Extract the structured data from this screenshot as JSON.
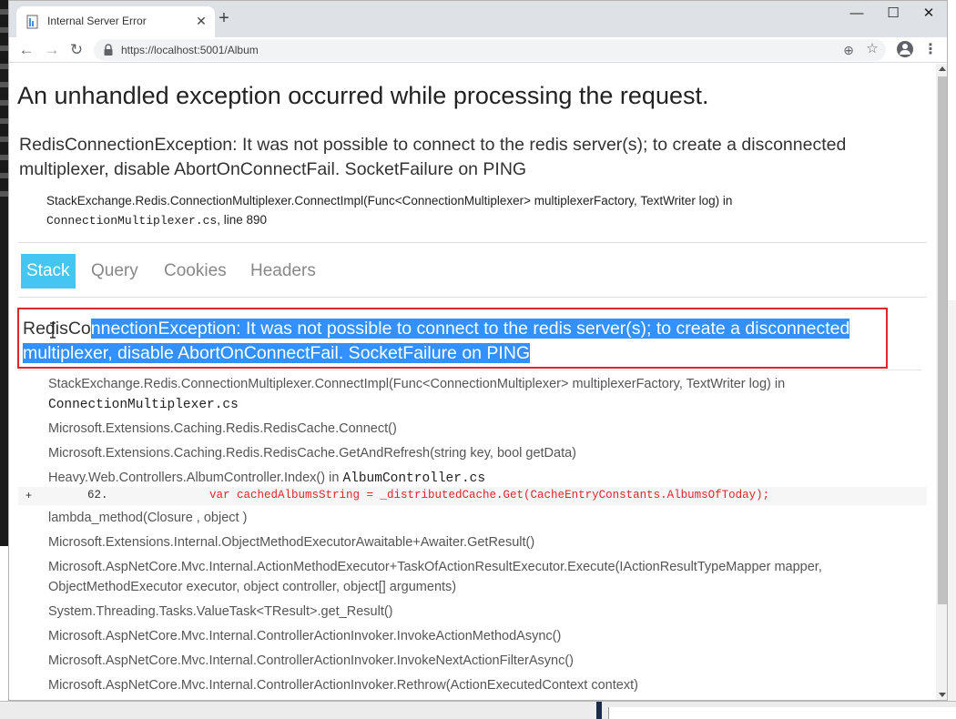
{
  "browser": {
    "tab_title": "Internal Server Error",
    "close_tab_glyph": "✕",
    "new_tab_glyph": "+",
    "url": "https://localhost:5001/Album",
    "minimize_glyph": "—",
    "maximize_glyph": "☐",
    "close_glyph": "✕",
    "back_glyph": "←",
    "forward_glyph": "→",
    "reload_glyph": "↻",
    "zoom_glyph": "⊕",
    "star_glyph": "☆",
    "menu_glyph": "⋮"
  },
  "page": {
    "heading": "An unhandled exception occurred while processing the request.",
    "title_error": "RedisConnectionException: It was not possible to connect to the redis server(s); to create a disconnected multiplexer, disable AbortOnConnectFail. SocketFailure on PING",
    "location_method": "StackExchange.Redis.ConnectionMultiplexer.ConnectImpl(Func<ConnectionMultiplexer> multiplexerFactory, TextWriter log) in",
    "location_file": "ConnectionMultiplexer.cs",
    "location_line": ", line 890",
    "tabs": [
      "Stack",
      "Query",
      "Cookies",
      "Headers"
    ],
    "selected_tab": "Stack",
    "stack_error": {
      "line1_unselected": "RedisCo",
      "line1_selected": "nnectionException: It was not possible to connect to the redis server(s); to create a disconnected",
      "line2_selected": "multiplexer, disable AbortOnConnectFail. SocketFailure on PING"
    },
    "frames": [
      {
        "method": "StackExchange.Redis.ConnectionMultiplexer.ConnectImpl(Func<ConnectionMultiplexer> multiplexerFactory, TextWriter log) in",
        "file": ""
      },
      {
        "method": "",
        "file": "ConnectionMultiplexer.cs"
      },
      {
        "method": "Microsoft.Extensions.Caching.Redis.RedisCache.Connect()",
        "file": ""
      },
      {
        "method": "Microsoft.Extensions.Caching.Redis.RedisCache.GetAndRefresh(string key, bool getData)",
        "file": ""
      },
      {
        "method": "Heavy.Web.Controllers.AlbumController.Index() in ",
        "file": "AlbumController.cs"
      },
      {
        "method": "lambda_method(Closure , object )",
        "file": ""
      },
      {
        "method": "Microsoft.Extensions.Internal.ObjectMethodExecutorAwaitable+Awaiter.GetResult()",
        "file": ""
      },
      {
        "method": "Microsoft.AspNetCore.Mvc.Internal.ActionMethodExecutor+TaskOfActionResultExecutor.Execute(IActionResultTypeMapper mapper,",
        "file": ""
      },
      {
        "method": "ObjectMethodExecutor executor, object controller, object[] arguments)",
        "file": ""
      },
      {
        "method": "System.Threading.Tasks.ValueTask<TResult>.get_Result()",
        "file": ""
      },
      {
        "method": "Microsoft.AspNetCore.Mvc.Internal.ControllerActionInvoker.InvokeActionMethodAsync()",
        "file": ""
      },
      {
        "method": "Microsoft.AspNetCore.Mvc.Internal.ControllerActionInvoker.InvokeNextActionFilterAsync()",
        "file": ""
      },
      {
        "method": "Microsoft.AspNetCore.Mvc.Internal.ControllerActionInvoker.Rethrow(ActionExecutedContext context)",
        "file": ""
      }
    ],
    "code_line": {
      "expander": "+",
      "line_number": "62.",
      "code": "var cachedAlbumsString = _distributedCache.Get(CacheEntryConstants.AlbumsOfToday);"
    }
  },
  "colors": {
    "accent_tab": "#44c5f2",
    "highlight_box": "#e0262d",
    "selection": "#3390ff",
    "code_red": "#e0262d"
  }
}
